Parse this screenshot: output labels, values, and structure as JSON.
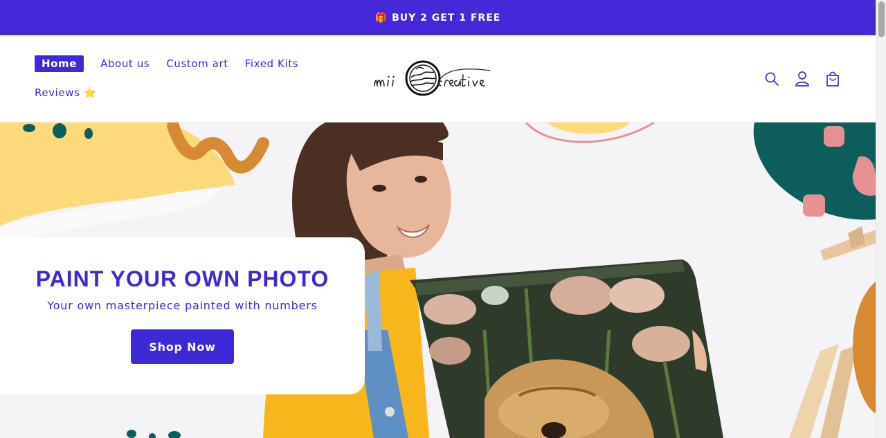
{
  "announcement": {
    "icon": "gift-icon",
    "text": "BUY 2 GET 1 FREE"
  },
  "nav": {
    "items": [
      {
        "label": "Home",
        "active": true
      },
      {
        "label": "About us",
        "active": false
      },
      {
        "label": "Custom art",
        "active": false
      },
      {
        "label": "Fixed Kits",
        "active": false
      }
    ],
    "second_row": [
      {
        "label": "Reviews ⭐",
        "active": false
      }
    ]
  },
  "logo": {
    "brand_lettering": "mii creative"
  },
  "header_icons": [
    "search-icon",
    "account-icon",
    "cart-icon"
  ],
  "hero": {
    "title": "PAINT YOUR OWN PHOTO",
    "subtitle": "Your own masterpiece painted with numbers",
    "cta_label": "Shop Now"
  },
  "colors": {
    "brand": "#3d2ad6",
    "announcement_bg": "#4628d8",
    "accent_yellow": "#fcd97a",
    "accent_orange": "#d68a34",
    "accent_teal": "#0e5d5d",
    "accent_pink": "#e59194"
  }
}
